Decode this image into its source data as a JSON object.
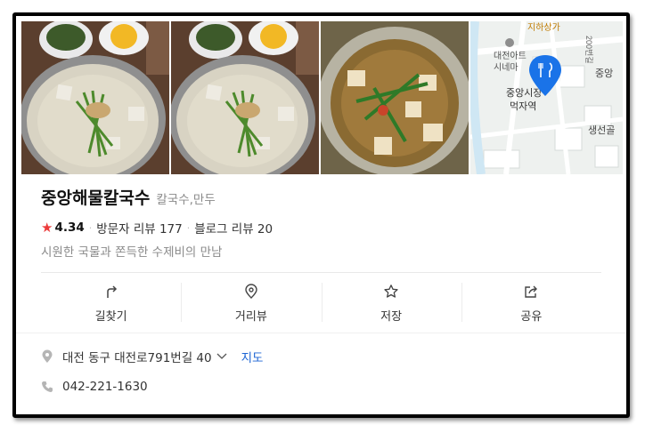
{
  "place": {
    "name": "중앙해물칼국수",
    "category": "칼국수,만두",
    "rating": "4.34",
    "visitor_reviews": "방문자 리뷰 177",
    "blog_reviews": "블로그 리뷰 20",
    "description": "시원한 국물과 쫀득한 수제비의 만남"
  },
  "map_thumb": {
    "labels": [
      "지하상가",
      "대전아트",
      "시네마",
      "중앙시장",
      "먹자역",
      "중앙",
      "생선골",
      "200번길"
    ]
  },
  "actions": [
    {
      "label": "길찾기",
      "icon": "directions-icon"
    },
    {
      "label": "거리뷰",
      "icon": "street-view-icon"
    },
    {
      "label": "저장",
      "icon": "star-icon"
    },
    {
      "label": "공유",
      "icon": "share-icon"
    }
  ],
  "address": {
    "text": "대전 동구 대전로791번길 40",
    "map_link": "지도"
  },
  "phone": "042-221-1630",
  "colors": {
    "accent_star": "#ec3b3b",
    "link": "#1d65d4",
    "map_pin": "#1a73e8"
  }
}
